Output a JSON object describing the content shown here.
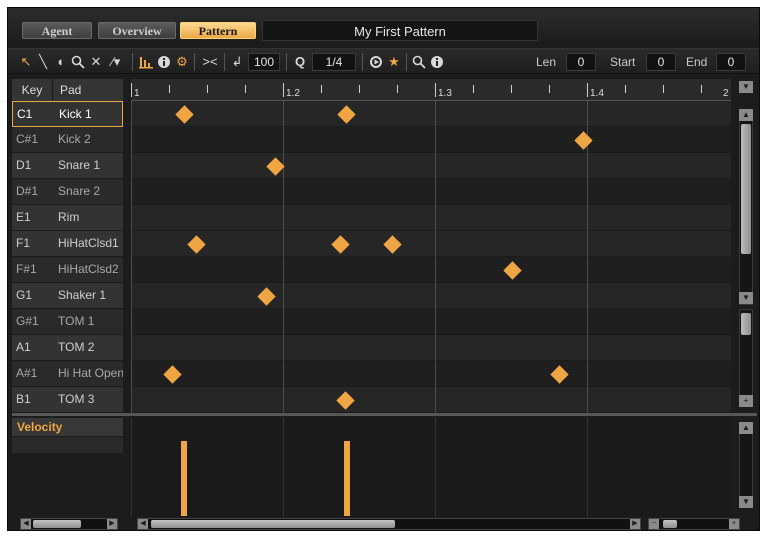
{
  "tabs": [
    {
      "label": "Agent",
      "active": false
    },
    {
      "label": "Overview",
      "active": false
    },
    {
      "label": "Pattern",
      "active": true
    }
  ],
  "pattern_title": "My First Pattern",
  "toolbar": {
    "velocity_value": "100",
    "quantize_value": "1/4",
    "len_label": "Len",
    "len_value": "0",
    "start_label": "Start",
    "start_value": "0",
    "end_label": "End",
    "end_value": "0",
    "icons": [
      "arrow-select-icon",
      "pencil-icon",
      "eraser-icon",
      "zoom-icon",
      "delete-icon",
      "line-draw-icon",
      "velocity-bars-icon",
      "info-icon",
      "settings-gear-icon",
      "reverse-icon",
      "velocity-arrow-icon",
      "quantize-icon",
      "play-loop-icon",
      "star-icon",
      "zoom-icon",
      "info-icon"
    ]
  },
  "list_headers": {
    "key": "Key",
    "pad": "Pad"
  },
  "rows": [
    {
      "key": "C1",
      "pad": "Kick 1",
      "sharp": false,
      "selected": true
    },
    {
      "key": "C#1",
      "pad": "Kick 2",
      "sharp": true,
      "selected": false
    },
    {
      "key": "D1",
      "pad": "Snare 1",
      "sharp": false,
      "selected": false
    },
    {
      "key": "D#1",
      "pad": "Snare 2",
      "sharp": true,
      "selected": false
    },
    {
      "key": "E1",
      "pad": "Rim",
      "sharp": false,
      "selected": false
    },
    {
      "key": "F1",
      "pad": "HiHatClsd1",
      "sharp": false,
      "selected": false
    },
    {
      "key": "F#1",
      "pad": "HiHatClsd2",
      "sharp": true,
      "selected": false
    },
    {
      "key": "G1",
      "pad": "Shaker 1",
      "sharp": false,
      "selected": false
    },
    {
      "key": "G#1",
      "pad": "TOM 1",
      "sharp": true,
      "selected": false
    },
    {
      "key": "A1",
      "pad": "TOM 2",
      "sharp": false,
      "selected": false
    },
    {
      "key": "A#1",
      "pad": "Hi Hat Open",
      "sharp": true,
      "selected": false
    },
    {
      "key": "B1",
      "pad": "TOM 3",
      "sharp": false,
      "selected": false
    }
  ],
  "ruler_labels": [
    "1",
    "1.2",
    "1.3",
    "1.4",
    "2"
  ],
  "timeline": {
    "start_beat": 1,
    "end_beat": 4.95,
    "beat_length": 1,
    "subdivision": 0.25
  },
  "notes": [
    {
      "row": 0,
      "beat": 1.35
    },
    {
      "row": 0,
      "beat": 2.42
    },
    {
      "row": 1,
      "beat": 3.98
    },
    {
      "row": 2,
      "beat": 1.95
    },
    {
      "row": 5,
      "beat": 1.43
    },
    {
      "row": 5,
      "beat": 2.38
    },
    {
      "row": 5,
      "beat": 2.72
    },
    {
      "row": 6,
      "beat": 3.51
    },
    {
      "row": 7,
      "beat": 1.89
    },
    {
      "row": 10,
      "beat": 1.27
    },
    {
      "row": 10,
      "beat": 3.82
    },
    {
      "row": 11,
      "beat": 2.41
    }
  ],
  "velocity_label": "Velocity",
  "velocity_max": 127,
  "velocity_bars": [
    {
      "beat": 1.35,
      "value": 100
    },
    {
      "beat": 2.42,
      "value": 100
    }
  ],
  "colors": {
    "accent": "#f0a544",
    "background": "#1c1c1c"
  }
}
